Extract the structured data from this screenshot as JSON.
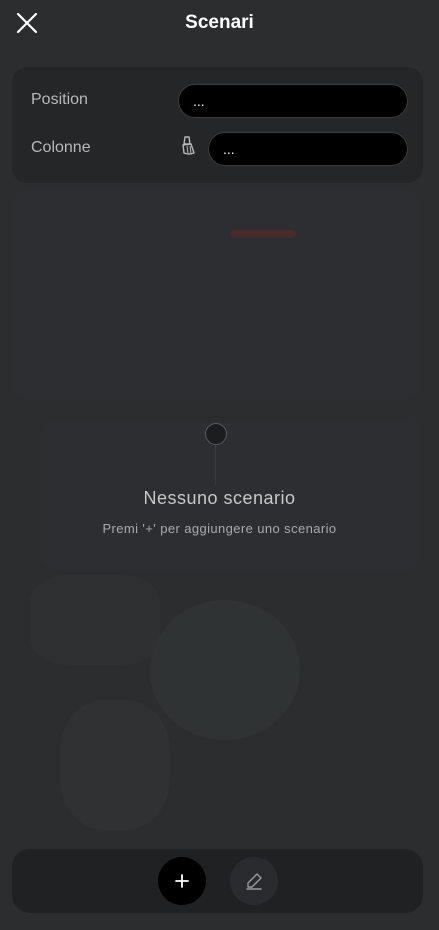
{
  "header": {
    "title": "Scenari",
    "close_icon": "close-icon"
  },
  "settings": {
    "position_label": "Position",
    "position_value": "...",
    "columns_label": "Colonne",
    "columns_value": "...",
    "brush_icon": "brush-icon"
  },
  "empty_state": {
    "title": "Nessuno scenario",
    "subtitle": "Premi '+' per aggiungere uno scenario"
  },
  "toolbar": {
    "add_icon": "plus-icon",
    "edit_icon": "pencil-icon"
  },
  "colors": {
    "background": "#2c2d2f",
    "card": "#252628",
    "field": "#000000",
    "toolbar": "#202123"
  }
}
